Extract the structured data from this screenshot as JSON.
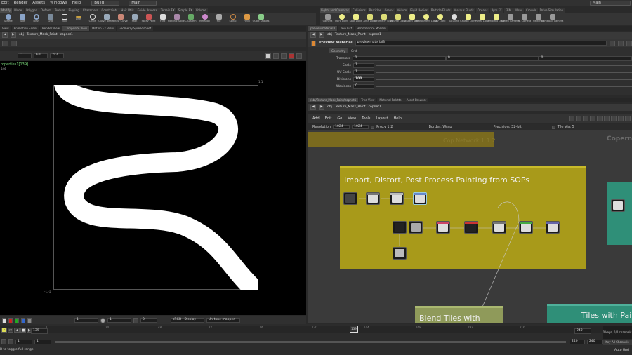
{
  "menu": [
    "Edit",
    "Render",
    "Assets",
    "Windows",
    "Help"
  ],
  "desktop": {
    "left": "Build",
    "center": "Main",
    "right": "Main"
  },
  "shelf_tabs_left": [
    "Modify",
    "Model",
    "Polygon",
    "Deform",
    "Texture",
    "Rigging",
    "Characters",
    "Constraints",
    "Hair Utils",
    "Guide Process",
    "Terrain FX",
    "Simple FX",
    "Volume"
  ],
  "shelf_tabs_right": [
    "Lights and Cameras",
    "Collisions",
    "Particles",
    "Grains",
    "Vellum",
    "Rigid Bodies",
    "Particle Fluids",
    "Viscous Fluids",
    "Oceans",
    "Pyro FX",
    "FEM",
    "Wires",
    "Crowds",
    "Drive Simulation"
  ],
  "tools_left": [
    "Sphere",
    "Tube",
    "Torus",
    "Grid",
    "Null",
    "Line",
    "Circle",
    "Curve Bezier",
    "Draw Curve",
    "Path",
    "Spray Paint",
    "Font",
    "Platonic Solids",
    "L-System",
    "Metaball",
    "File",
    "Spiral",
    "Helix",
    "Quick Shapes"
  ],
  "tools_right": [
    "Camera",
    "Point Light",
    "Spot Light",
    "Area Light",
    "Geometry Light",
    "Volume Light",
    "Distant Light",
    "Environment Light",
    "Sky Light",
    "GI Light",
    "Caustic Light",
    "Portal Light",
    "Ambient Light",
    "Stereo Camera",
    "VR Camera",
    "Switcher",
    "Gamepad Camera"
  ],
  "left_tabs": [
    "View",
    "Animation Editor",
    "Render View",
    "Composite View",
    "Motion FX View",
    "Geometry Spreadsheet"
  ],
  "left_path": [
    "obj",
    "Texture_Mask_Paint",
    "copnet1"
  ],
  "viewer_toolbar": {
    "mode": "C",
    "scale": "Full",
    "res": "2x2"
  },
  "viewer": {
    "label": "roperties1[139]",
    "sub": "346",
    "corner_tr": "1,1",
    "corner_bl": "-1,-1"
  },
  "viewer_bottom": {
    "frame_a": "1",
    "frame_b": "1",
    "frame_c": "0",
    "display": "sRGB - Display",
    "tonemap": "Un-tone-mapped"
  },
  "right_tabs_top": [
    "previewmaterial3",
    "Take List",
    "Performance Monitor"
  ],
  "right_path_top": [
    "obj",
    "Texture_Mask_Paint",
    "copnet1"
  ],
  "parm": {
    "node_type": "Preview Material",
    "node_name": "previewmaterial3",
    "subtabs": [
      "Geometry",
      "Grid"
    ],
    "rows": [
      {
        "label": "Translate",
        "values": [
          "0",
          "0",
          "0"
        ]
      },
      {
        "label": "Scale",
        "values": [
          "1"
        ]
      },
      {
        "label": "UV Scale",
        "values": [
          "1"
        ]
      },
      {
        "label": "Divisions",
        "values": [
          "100"
        ]
      },
      {
        "label": "Waviness",
        "values": [
          "0"
        ]
      }
    ]
  },
  "right_tabs_net": [
    "/obj/Texture_Mask_Paint/copnet1",
    "Tree View",
    "Material Palette",
    "Asset Browser"
  ],
  "right_path_net": [
    "obj",
    "Texture_Mask_Paint",
    "copnet1"
  ],
  "net_menu": [
    "Add",
    "Edit",
    "Go",
    "View",
    "Tools",
    "Layout",
    "Help"
  ],
  "net_info": {
    "res_label": "Resolution",
    "res_x": "1024",
    "res_y": "1024",
    "proxy": "Proxy 1:2",
    "border": "Border: Wrap",
    "precision": "Precision: 32-bit",
    "tile": "Tile Vis: 5"
  },
  "network": {
    "top_partial": "Cop Network 1 1:2",
    "right_partial": "Copern",
    "main_box": "Import, Distort, Post Process Painting from SOPs",
    "box2": "Blend Tiles with",
    "box3": "Tiles with Pai"
  },
  "timeline": {
    "frame": "139",
    "start": "1",
    "end": "240",
    "end2": "240",
    "range_a": "1",
    "range_b": "1",
    "ticks": [
      "1",
      "24",
      "48",
      "72",
      "96",
      "120",
      "144",
      "168",
      "192",
      "216"
    ],
    "keys": "0 keys, 0/0 channels",
    "key_all": "Key All Channels",
    "auto": "Auto Upd",
    "status": "B to toggle full range"
  },
  "colors": {
    "yellow_box": "#a89a1a",
    "teal_box": "#2f8f78",
    "green_box": "#8f9a5a",
    "dark_yellow": "#7a6a1e"
  }
}
